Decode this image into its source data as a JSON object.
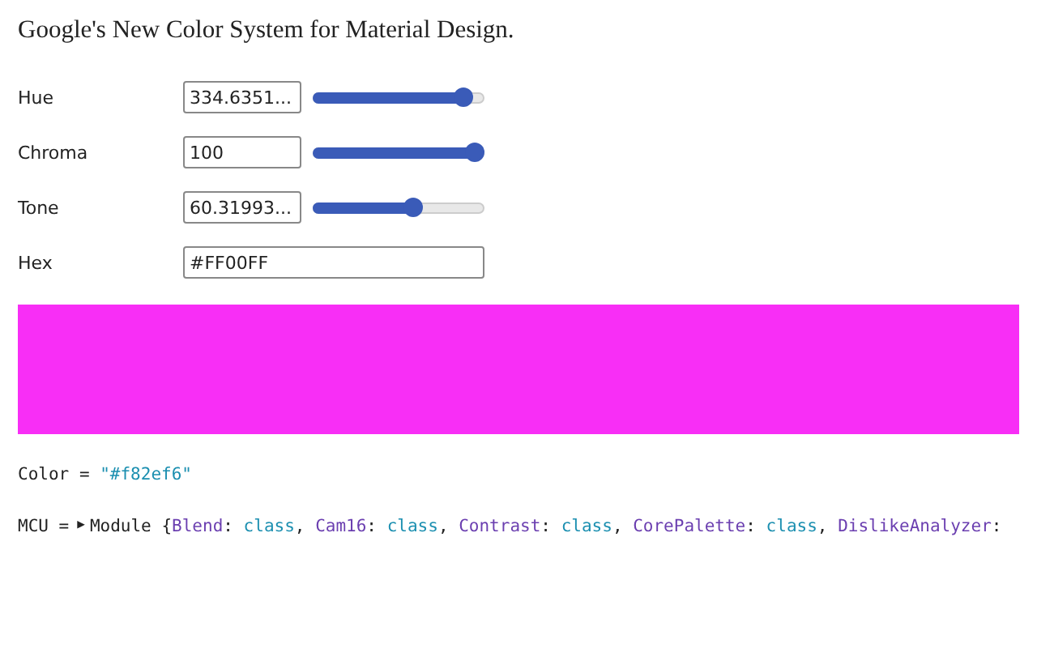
{
  "title": "Google's New Color System for Material Design.",
  "controls": [
    {
      "label": "Hue",
      "value": "334.6351...",
      "kind": "slider",
      "level": 0.93
    },
    {
      "label": "Chroma",
      "value": "100",
      "kind": "slider",
      "level": 1.0
    },
    {
      "label": "Tone",
      "value": "60.31993...",
      "kind": "slider",
      "level": 0.6
    },
    {
      "label": "Hex",
      "value": "#FF00FF",
      "kind": "text"
    }
  ],
  "swatch": {
    "color": "#f82ef6"
  },
  "color_output": {
    "name": "Color",
    "operator": "=",
    "value": "\"#f82ef6\""
  },
  "mcu_output": {
    "name": "MCU",
    "operator": "=",
    "toggle": "▶",
    "expanded": false,
    "prefix": "Module {",
    "entries": [
      {
        "key": "Blend",
        "colon": ":",
        "value": "class",
        "comma": ","
      },
      {
        "key": "Cam16",
        "colon": ":",
        "value": "class",
        "comma": ","
      },
      {
        "key": "Contrast",
        "colon": ":",
        "value": "class",
        "comma": ","
      },
      {
        "key": "CorePalette",
        "colon": ":",
        "value": "class",
        "comma": ","
      },
      {
        "key": "DislikeAnalyzer",
        "colon": ":"
      }
    ]
  }
}
